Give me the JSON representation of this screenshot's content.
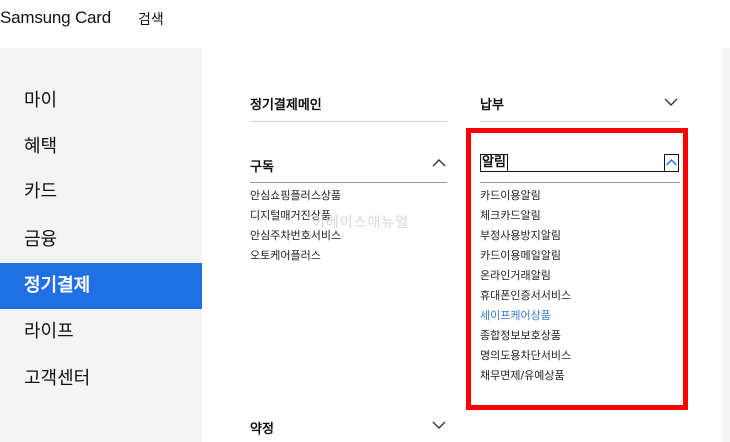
{
  "header": {
    "brand": "Samsung Card",
    "search_label": "검색"
  },
  "sidebar": {
    "items": [
      {
        "label": "마이"
      },
      {
        "label": "혜택"
      },
      {
        "label": "카드"
      },
      {
        "label": "금융"
      },
      {
        "label": "정기결제",
        "active": true
      },
      {
        "label": "라이프"
      },
      {
        "label": "고객센터"
      }
    ]
  },
  "left_column": {
    "main_heading": "정기결제메인",
    "section_heading": "구독",
    "items": [
      "안심쇼핑플러스상품",
      "디지털매거진상품",
      "안심주차번호서비스",
      "오토케어플러스"
    ],
    "bottom_heading": "약정"
  },
  "right_column": {
    "top_heading": "납부",
    "section_heading": "알림",
    "items": [
      "카드이용알림",
      "체크카드알림",
      "부정사용방지알림",
      "카드이용메일알림",
      "온라인거래알림",
      "휴대폰인증서서비스",
      "세이프케어상품",
      "종합정보보호상품",
      "명의도용차단서비스",
      "채무면제/유예상품"
    ],
    "highlight_item": "세이프케어상품"
  },
  "watermark": "이베이스매뉴얼",
  "colors": {
    "accent": "#1f6fe5",
    "highlight": "#3a78d8",
    "annotation": "#ff0000",
    "sidebar_bg": "#f4f4f5"
  }
}
